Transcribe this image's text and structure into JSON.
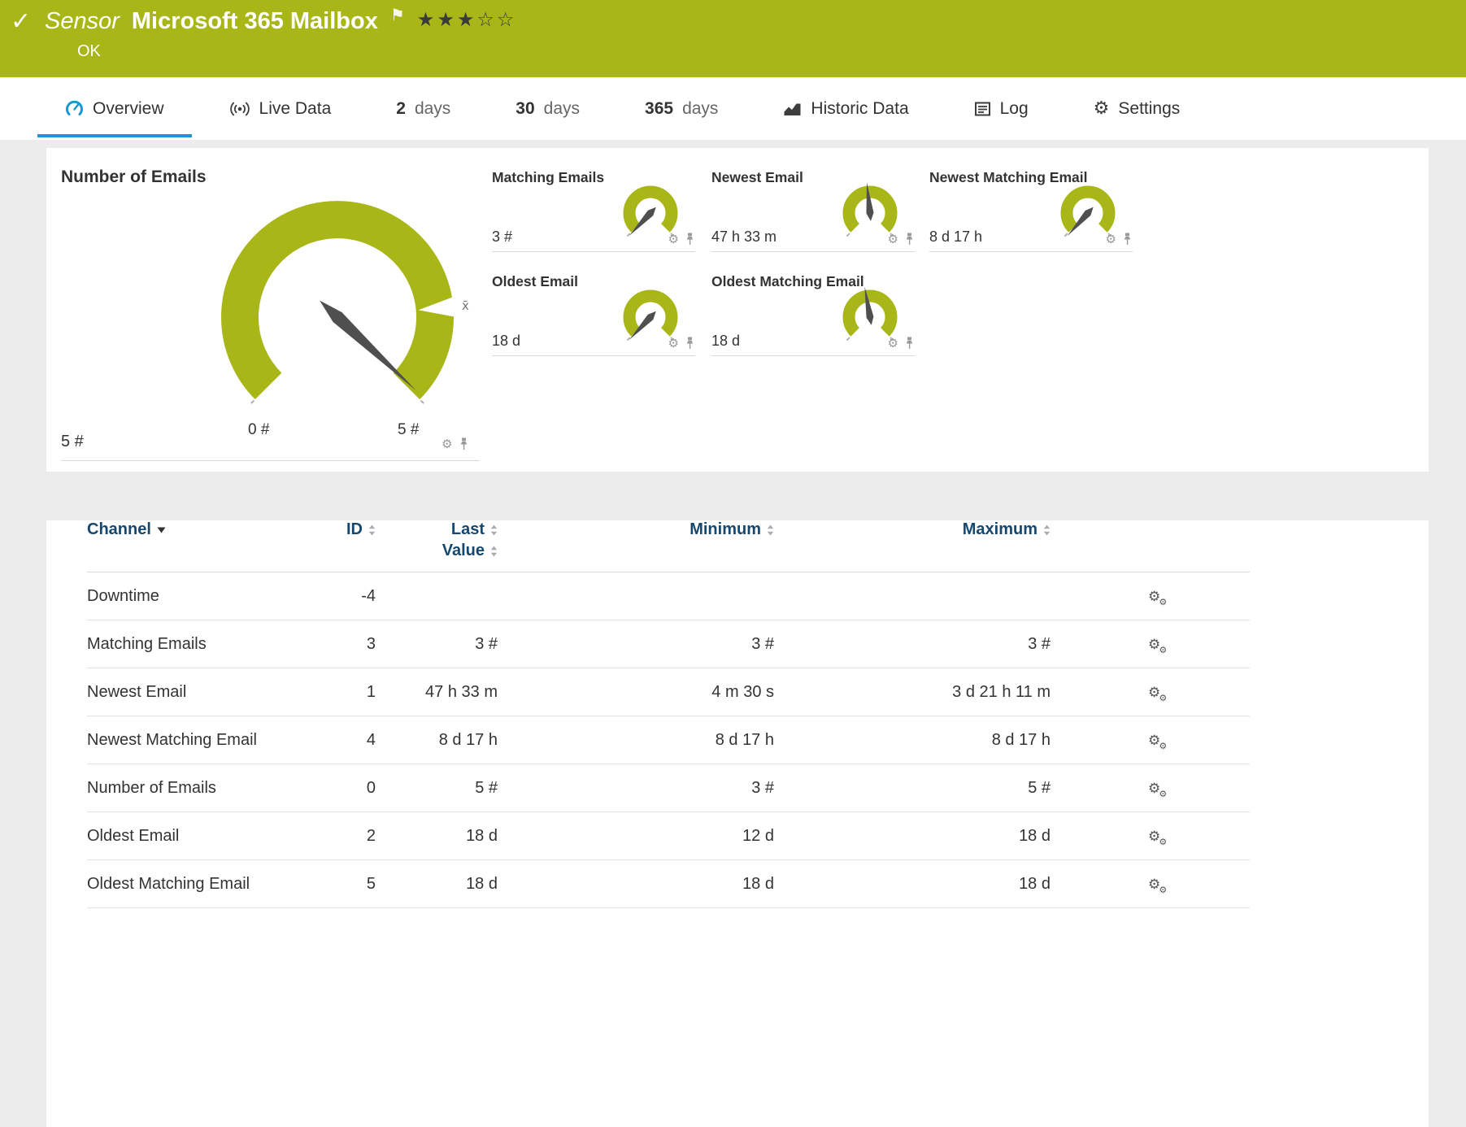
{
  "header": {
    "kind": "Sensor",
    "title": "Microsoft 365 Mailbox",
    "status": "OK",
    "rating_filled": 3,
    "rating_total": 5
  },
  "tabs": [
    {
      "id": "overview",
      "label": "Overview",
      "icon": "gauge",
      "active": true
    },
    {
      "id": "live-data",
      "label": "Live Data",
      "icon": "live"
    },
    {
      "id": "2-days",
      "num": "2",
      "label": "days"
    },
    {
      "id": "30-days",
      "num": "30",
      "label": "days"
    },
    {
      "id": "365-days",
      "num": "365",
      "label": "days"
    },
    {
      "id": "historic-data",
      "label": "Historic Data",
      "icon": "historic"
    },
    {
      "id": "log",
      "label": "Log",
      "icon": "log"
    },
    {
      "id": "settings",
      "label": "Settings",
      "icon": "gear"
    }
  ],
  "gauges": {
    "main": {
      "title": "Number of Emails",
      "value": "5 #",
      "scale_min": "0 #",
      "scale_max": "5 #",
      "needle_deg": 133,
      "marker_deg": 85,
      "marker_label": "x̄"
    },
    "small": [
      {
        "title": "Matching Emails",
        "value": "3 #",
        "needle_deg": 223
      },
      {
        "title": "Newest Email",
        "value": "47 h 33 m",
        "needle_deg": -6
      },
      {
        "title": "Newest Matching Email",
        "value": "8 d 17 h",
        "needle_deg": 222
      },
      {
        "title": "Oldest Email",
        "value": "18 d",
        "needle_deg": 223
      },
      {
        "title": "Oldest Matching Email",
        "value": "18 d",
        "needle_deg": -10
      }
    ]
  },
  "table": {
    "columns": [
      "Channel",
      "ID",
      "Last Value",
      "Minimum",
      "Maximum"
    ],
    "rows": [
      {
        "channel": "Downtime",
        "id": "-4",
        "last": "",
        "min": "",
        "max": ""
      },
      {
        "channel": "Matching Emails",
        "id": "3",
        "last": "3 #",
        "min": "3 #",
        "max": "3 #"
      },
      {
        "channel": "Newest Email",
        "id": "1",
        "last": "47 h 33 m",
        "min": "4 m 30 s",
        "max": "3 d 21 h 11 m"
      },
      {
        "channel": "Newest Matching Email",
        "id": "4",
        "last": "8 d 17 h",
        "min": "8 d 17 h",
        "max": "8 d 17 h"
      },
      {
        "channel": "Number of Emails",
        "id": "0",
        "last": "5 #",
        "min": "3 #",
        "max": "5 #"
      },
      {
        "channel": "Oldest Email",
        "id": "2",
        "last": "18 d",
        "min": "12 d",
        "max": "18 d"
      },
      {
        "channel": "Oldest Matching Email",
        "id": "5",
        "last": "18 d",
        "min": "18 d",
        "max": "18 d"
      }
    ]
  },
  "colors": {
    "green": "#a8b618",
    "tab_blue": "#1b97d4",
    "table_header": "#16486f",
    "needle": "#4f4f4f"
  }
}
